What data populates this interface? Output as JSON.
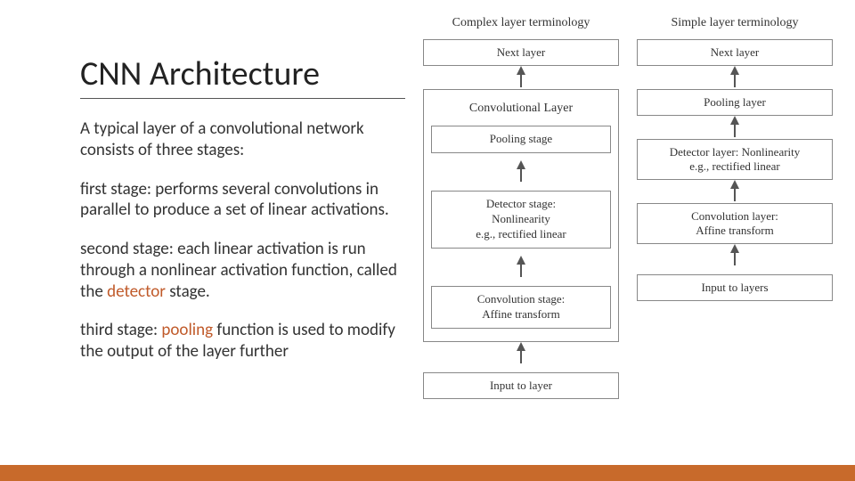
{
  "title": "CNN Architecture",
  "p1": "A typical layer of a convolutional network consists of three stages:",
  "p2a": " ﬁrst stage: performs several convolutions in parallel to produce a set of linear activations.",
  "p3a": "second stage: each linear activation is run through a nonlinear activation function, called the ",
  "p3hl": "detector",
  "p3b": " stage.",
  "p4a": "third stage: ",
  "p4hl": "pooling",
  "p4b": " function is used to modify the output of the layer further",
  "diagram": {
    "left": {
      "header": "Complex layer terminology",
      "top": "Next layer",
      "groupTitle": "Convolutional Layer",
      "items": [
        "Pooling stage",
        "Detector stage:\nNonlinearity\ne.g., rectified linear",
        "Convolution stage:\nAffine transform"
      ],
      "bottom": "Input to layer"
    },
    "right": {
      "header": "Simple layer terminology",
      "top": "Next layer",
      "items": [
        "Pooling layer",
        "Detector layer: Nonlinearity\ne.g., rectified linear",
        "Convolution layer:\nAffine transform"
      ],
      "bottom": "Input to layers"
    }
  }
}
